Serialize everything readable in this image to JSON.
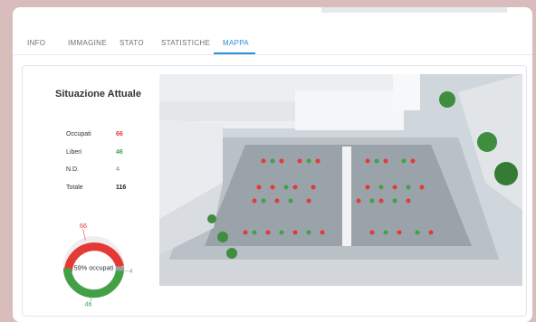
{
  "tabs": [
    "INFO",
    "IMMAGINE",
    "STATO",
    "STATISTICHE",
    "MAPPA"
  ],
  "active_tab": "MAPPA",
  "panel": {
    "title": "Situazione Attuale",
    "stats": [
      {
        "label": "Occupati",
        "value": "66",
        "color": "#e53935"
      },
      {
        "label": "Liberi",
        "value": "46",
        "color": "#43a047"
      },
      {
        "label": "N.D.",
        "value": "4",
        "color": "#9e9e9e"
      },
      {
        "label": "Totale",
        "value": "116",
        "color": "#222222"
      }
    ]
  },
  "donut": {
    "center_label": "59% occupati",
    "occupied_label": "66",
    "free_label": "46",
    "nd_label": "4",
    "occupied": 66,
    "free": 46,
    "nd": 4
  },
  "colors": {
    "accent": "#2b8fd6",
    "occupied": "#e53935",
    "free": "#43a047",
    "nd": "#9e9e9e"
  }
}
